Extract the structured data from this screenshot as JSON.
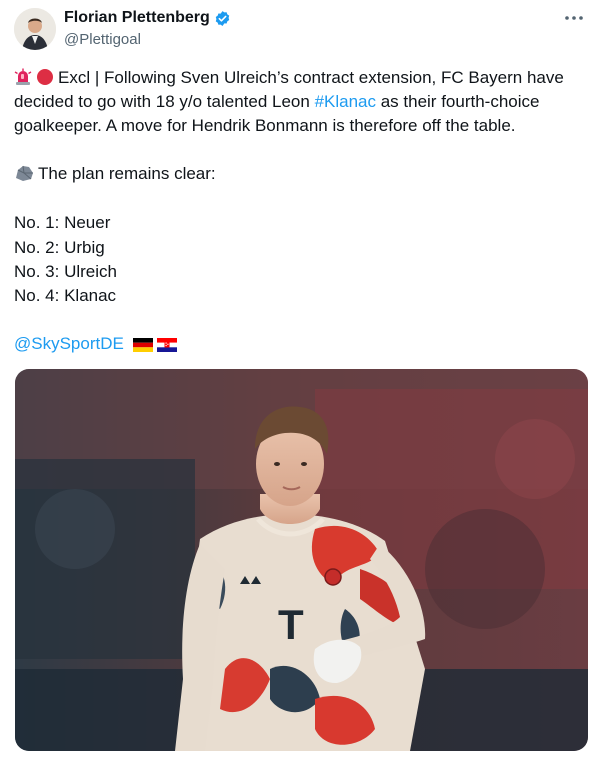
{
  "author": {
    "name": "Florian Plettenberg",
    "handle": "@Plettigoal"
  },
  "tweet": {
    "line1_prefix": "Excl | Following Sven Ulreich’s contract extension, FC Bayern have",
    "line2_prefix": "decided to go with 18 y/o talented Leon ",
    "line2_hashtag": "#Klanac",
    "line2_suffix": " as their fourth-choice",
    "line3": "goalkeeper. A move for Hendrik Bonmann is therefore off the table.",
    "plan_heading": "The plan remains clear:",
    "keepers": [
      "No. 1: Neuer",
      "No. 2: Urbig",
      "No. 3: Ulreich",
      "No. 4: Klanac"
    ],
    "mention": "@SkySportDE"
  },
  "icons": {
    "siren": "police-light-icon",
    "dot": "red-circle-icon",
    "rock": "rock-icon",
    "verified": "verified-badge-icon",
    "more": "more-options-icon",
    "flag_de": "germany-flag-icon",
    "flag_hr": "croatia-flag-icon"
  },
  "colors": {
    "link": "#1d9bf0",
    "text": "#0f1419",
    "secondary": "#536471",
    "verified": "#1d9bf0"
  }
}
